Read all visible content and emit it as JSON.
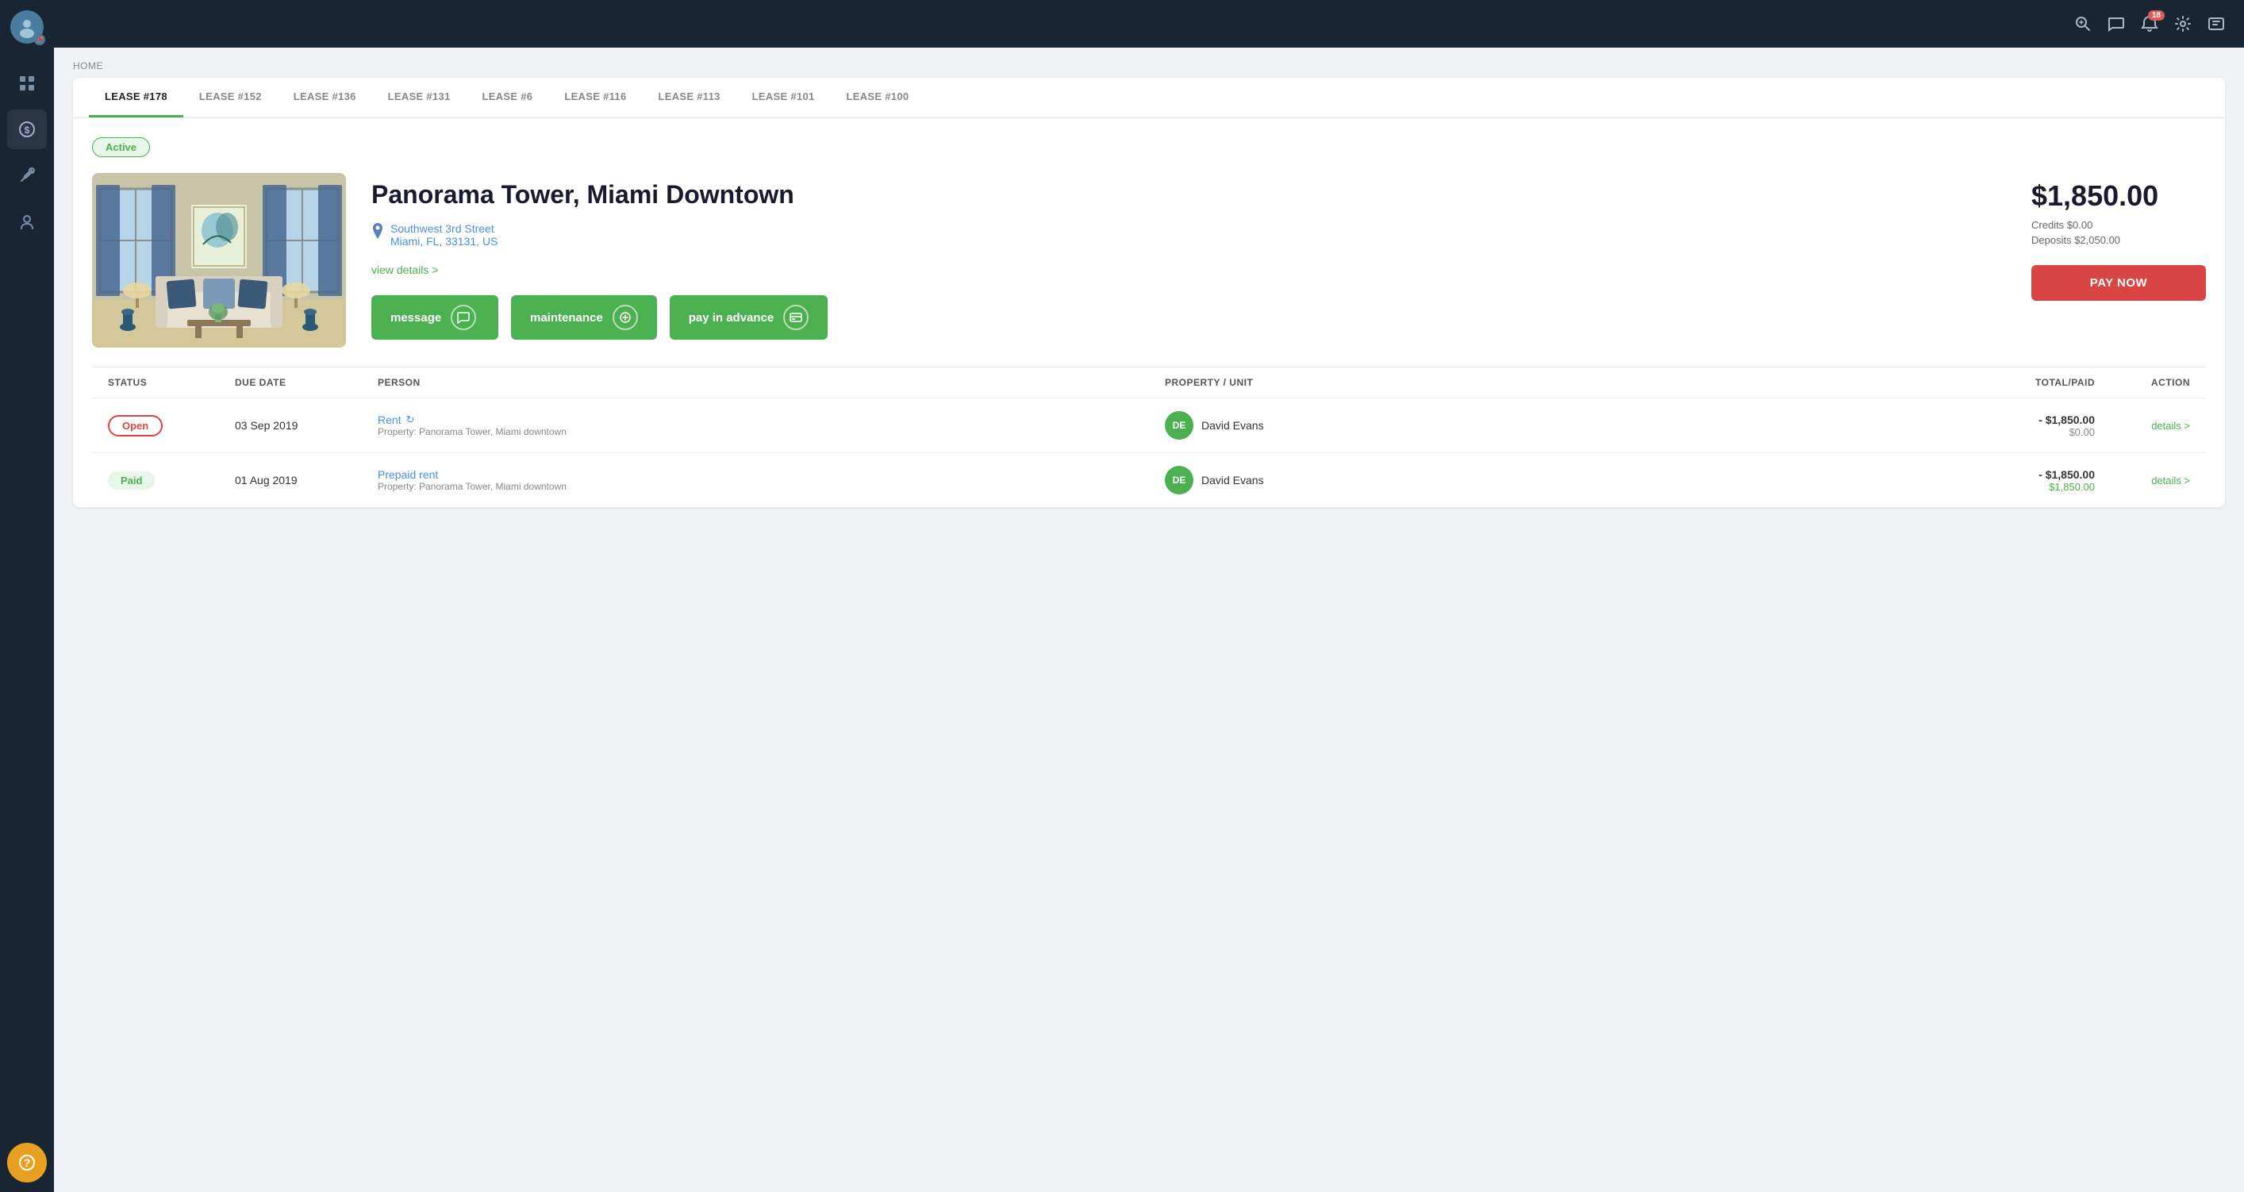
{
  "sidebar": {
    "items": [
      {
        "icon": "⋮⋮⋮",
        "name": "dashboard",
        "label": "Dashboard"
      },
      {
        "icon": "$",
        "name": "payments",
        "label": "Payments",
        "active": true
      },
      {
        "icon": "🔧",
        "name": "maintenance",
        "label": "Maintenance"
      },
      {
        "icon": "👤",
        "name": "tenants",
        "label": "Tenants"
      }
    ],
    "support_icon": "?",
    "support_label": "Support"
  },
  "topbar": {
    "notification_count": "18",
    "icons": [
      "search",
      "message",
      "settings",
      "profile"
    ]
  },
  "breadcrumb": "HOME",
  "tabs": [
    {
      "label": "LEASE #178",
      "active": true
    },
    {
      "label": "LEASE #152"
    },
    {
      "label": "LEASE #136"
    },
    {
      "label": "LEASE #131"
    },
    {
      "label": "LEASE #6"
    },
    {
      "label": "LEASE #116"
    },
    {
      "label": "LEASE #113"
    },
    {
      "label": "LEASE #101"
    },
    {
      "label": "LEASE #100"
    }
  ],
  "lease": {
    "status": "Active",
    "property_name": "Panorama Tower, Miami Downtown",
    "address_line1": "Southwest 3rd Street",
    "address_line2": "Miami, FL, 33131, US",
    "view_details_label": "view details >",
    "amount": "$1,850.00",
    "credits": "Credits $0.00",
    "deposits": "Deposits $2,050.00",
    "pay_now_label": "PAY NOW",
    "message_label": "message",
    "maintenance_label": "maintenance",
    "pay_in_advance_label": "pay in advance"
  },
  "table": {
    "headers": [
      "STATUS",
      "DUE DATE",
      "PERSON",
      "PROPERTY / UNIT",
      "TOTAL/PAID",
      "ACTION"
    ],
    "rows": [
      {
        "status": "Open",
        "status_type": "open",
        "due_date": "03 Sep 2019",
        "charge_label": "Rent",
        "charge_sub": "Property: Panorama Tower, Miami downtown",
        "person_initials": "DE",
        "person_name": "David Evans",
        "total": "- $1,850.00",
        "paid": "$0.00",
        "action": "details >"
      },
      {
        "status": "Paid",
        "status_type": "paid",
        "due_date": "01 Aug 2019",
        "charge_label": "Prepaid rent",
        "charge_sub": "Property: Panorama Tower, Miami downtown",
        "person_initials": "DE",
        "person_name": "David Evans",
        "total": "- $1,850.00",
        "paid": "$1,850.00",
        "action": "details >"
      }
    ]
  }
}
